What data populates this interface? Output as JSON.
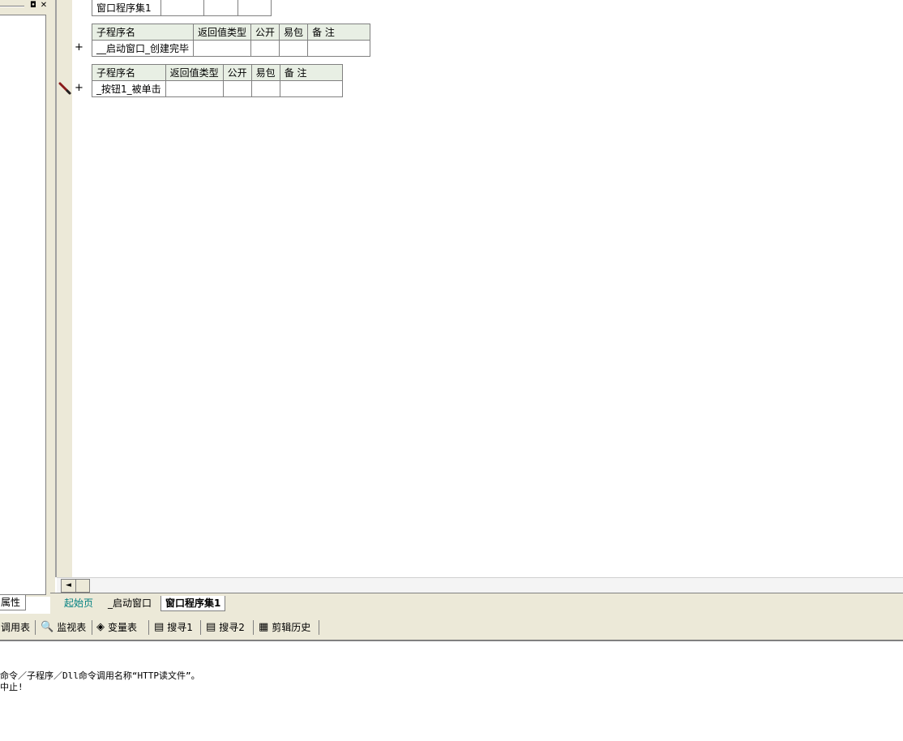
{
  "left_panel": {
    "controls": {
      "restore": "◘",
      "close": "✕"
    },
    "properties_tab": "属性"
  },
  "code_tables": {
    "assembly_row": {
      "name": "窗口程序集1"
    },
    "sub1": {
      "headers": [
        "子程序名",
        "返回值类型",
        "公开",
        "易包",
        "备 注"
      ],
      "name": "__启动窗口_创建完毕"
    },
    "sub2": {
      "headers": [
        "子程序名",
        "返回值类型",
        "公开",
        "易包",
        "备 注"
      ],
      "name": "_按钮1_被单击"
    },
    "expand_symbol": "+"
  },
  "scrollbar": {
    "left_arrow": "◄"
  },
  "editor_tabs": [
    {
      "label": "起始页"
    },
    {
      "label": "_启动窗口"
    },
    {
      "label": "窗口程序集1"
    }
  ],
  "bottom_tabs": [
    {
      "label": "调用表",
      "icon": ""
    },
    {
      "label": "监视表",
      "icon": "🔍"
    },
    {
      "label": "变量表",
      "icon": "◈"
    },
    {
      "label": "搜寻1",
      "icon": "▤"
    },
    {
      "label": "搜寻2",
      "icon": "▤"
    },
    {
      "label": "剪辑历史",
      "icon": "▦"
    }
  ],
  "output": {
    "line1": "命令／子程序／Dll命令调用名称“HTTP读文件”。",
    "line2": "中止!"
  },
  "colors": {
    "header_bg": "#e8efe4",
    "tab_link": "#008080",
    "panel_bg": "#ece9d8"
  }
}
